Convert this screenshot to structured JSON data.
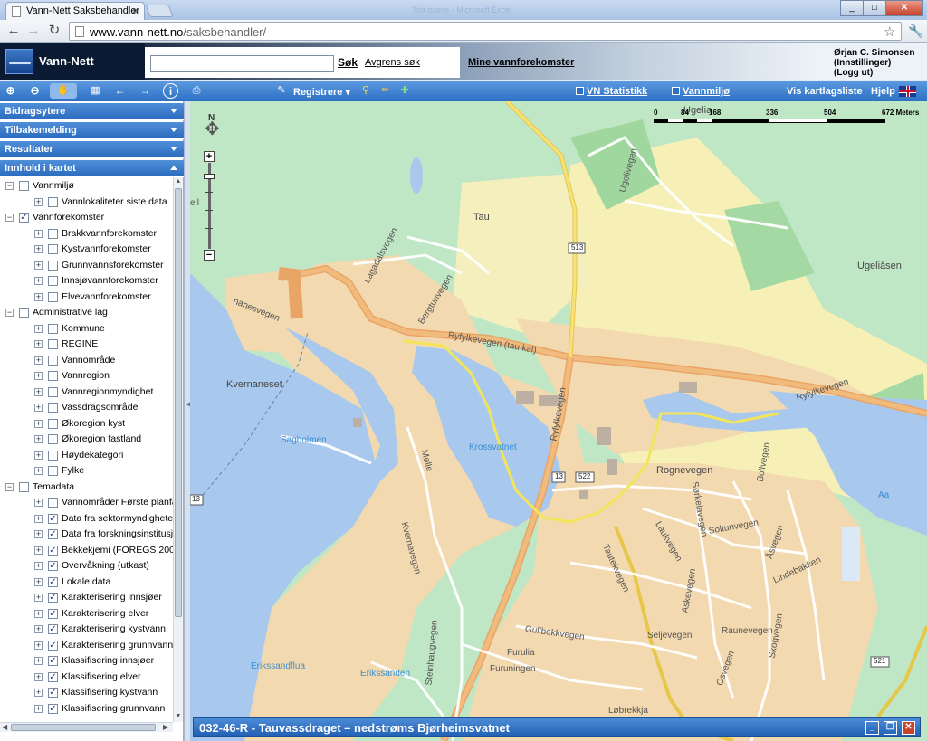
{
  "browser": {
    "tab_title": "Vann-Nett Saksbehandler",
    "tab_close": "×",
    "ghost_title": "Tint guess - Microsoft Excel",
    "url_host": "www.vann-nett.no",
    "url_path": "/saksbehandler/",
    "nav_back": "←",
    "nav_forward": "→",
    "nav_reload": "↻",
    "star": "☆",
    "wrench": "🔧",
    "win_min": "_",
    "win_max": "□",
    "win_close": "✕"
  },
  "header": {
    "app_name": "Vann-Nett",
    "search_placeholder": "",
    "search_button": "Søk",
    "refine_link": "Avgrens søk",
    "my_water_link": "Mine vannforekomster",
    "user_name": "Ørjan C. Simonsen",
    "user_settings": "(Innstillinger)",
    "user_logout": "(Logg ut)"
  },
  "toolbar": {
    "register": "Registrere",
    "vn_stats": "VN Statistikk",
    "water_env": "Vannmiljø",
    "layer_list": "Vis kartlagsliste",
    "help": "Hjelp"
  },
  "sidebar": {
    "accordions": [
      "Bidragsytere",
      "Tilbakemelding",
      "Resultater",
      "Innhold i kartet"
    ],
    "tree": [
      {
        "level": 0,
        "label": "Vannmiljø",
        "checked": false,
        "expander": "−"
      },
      {
        "level": 1,
        "label": "Vannlokaliteter siste data",
        "checked": false,
        "expander": "+"
      },
      {
        "level": 0,
        "label": "Vannforekomster",
        "checked": true,
        "expander": "−"
      },
      {
        "level": 1,
        "label": "Brakkvannforekomster",
        "checked": false,
        "expander": "+"
      },
      {
        "level": 1,
        "label": "Kystvannforekomster",
        "checked": false,
        "expander": "+"
      },
      {
        "level": 1,
        "label": "Grunnvannsforekomster",
        "checked": false,
        "expander": "+"
      },
      {
        "level": 1,
        "label": "Innsjøvannforekomster",
        "checked": false,
        "expander": "+"
      },
      {
        "level": 1,
        "label": "Elvevannforekomster",
        "checked": false,
        "expander": "+"
      },
      {
        "level": 0,
        "label": "Administrative lag",
        "checked": false,
        "expander": "−"
      },
      {
        "level": 1,
        "label": "Kommune",
        "checked": false,
        "expander": "+"
      },
      {
        "level": 1,
        "label": "REGINE",
        "checked": false,
        "expander": "+"
      },
      {
        "level": 1,
        "label": "Vannområde",
        "checked": false,
        "expander": "+"
      },
      {
        "level": 1,
        "label": "Vannregion",
        "checked": false,
        "expander": "+"
      },
      {
        "level": 1,
        "label": "Vannregionmyndighet",
        "checked": false,
        "expander": "+"
      },
      {
        "level": 1,
        "label": "Vassdragsområde",
        "checked": false,
        "expander": "+"
      },
      {
        "level": 1,
        "label": "Økoregion kyst",
        "checked": false,
        "expander": "+"
      },
      {
        "level": 1,
        "label": "Økoregion fastland",
        "checked": false,
        "expander": "+"
      },
      {
        "level": 1,
        "label": "Høydekategori",
        "checked": false,
        "expander": "+"
      },
      {
        "level": 1,
        "label": "Fylke",
        "checked": false,
        "expander": "+"
      },
      {
        "level": 0,
        "label": "Temadata",
        "checked": false,
        "expander": "−"
      },
      {
        "level": 1,
        "label": "Vannområder Første planfa",
        "checked": false,
        "expander": "+"
      },
      {
        "level": 1,
        "label": "Data fra sektormyndighete",
        "checked": true,
        "expander": "+"
      },
      {
        "level": 1,
        "label": "Data fra forskningsinstitusj",
        "checked": true,
        "expander": "+"
      },
      {
        "level": 1,
        "label": "Bekkekjemi (FOREGS 2008",
        "checked": true,
        "expander": "+"
      },
      {
        "level": 1,
        "label": "Overvåkning (utkast)",
        "checked": true,
        "expander": "+"
      },
      {
        "level": 1,
        "label": "Lokale data",
        "checked": true,
        "expander": "+"
      },
      {
        "level": 1,
        "label": "Karakterisering innsjøer",
        "checked": true,
        "expander": "+"
      },
      {
        "level": 1,
        "label": "Karakterisering elver",
        "checked": true,
        "expander": "+"
      },
      {
        "level": 1,
        "label": "Karakterisering kystvann",
        "checked": true,
        "expander": "+"
      },
      {
        "level": 1,
        "label": "Karakterisering grunnvann",
        "checked": true,
        "expander": "+"
      },
      {
        "level": 1,
        "label": "Klassifisering innsjøer",
        "checked": true,
        "expander": "+"
      },
      {
        "level": 1,
        "label": "Klassifisering elver",
        "checked": true,
        "expander": "+"
      },
      {
        "level": 1,
        "label": "Klassifisering kystvann",
        "checked": true,
        "expander": "+"
      },
      {
        "level": 1,
        "label": "Klassifisering grunnvann",
        "checked": true,
        "expander": "+"
      }
    ]
  },
  "map": {
    "scale_labels": [
      "0",
      "84",
      "168",
      "336",
      "504",
      "672 Meters"
    ],
    "pan_label": "N",
    "zoom_in": "+",
    "zoom_out": "−",
    "labels": {
      "ugelia": "Ugelia",
      "ugelivegen": "Ugelivegen",
      "tau": "Tau",
      "ugeliasen": "Ugeliåsen",
      "ell": "ell",
      "road513": "513",
      "nanesvegen": "nanesvegen",
      "bergtunvegen": "Bergtunvegen",
      "lagadalsvegen": "Lagadalsvegen",
      "ryfylkevegen_taukai": "Ryfylkevegen (tau kai)",
      "ryfylkevegen": "Ryfylkevegen",
      "ryfylkevegen_e": "Ryfylkevegen",
      "kvernaneset": "Kvernaneset",
      "sagholmen": "Sagholmen",
      "krossvatnet": "Krossvatnet",
      "kvernavegen": "Kvernavegen",
      "molle": "Mølle",
      "road13a": "13",
      "road13b": "13",
      "road522": "522",
      "rognevegen": "Rognevegen",
      "sorkelavegen": "Sørkelavegen",
      "bollvegen": "Bollvegen",
      "soltunvegen": "Soltunvegen",
      "laukvegen": "Laukvegen",
      "tautekvegen": "Tautekvegen",
      "asvegen": "Åsvegen",
      "lindebakken": "Lindebakken",
      "aa": "Aa",
      "seljevegen": "Seljevegen",
      "raunevegen": "Raunevegen",
      "asbakken": "Askevegen",
      "gullbekkvegen": "Gullbekkvegen",
      "furulia": "Furulia",
      "furuningen": "Furuningen",
      "eriksandflua": "Erikssandflua",
      "erikssanden": "Erikssanden",
      "osloveien": "Osvegen",
      "skogvegen": "Skogvegen",
      "lobrekkja": "Løbrekkja",
      "road521": "521",
      "steinhaugvegen": "Steinhaugvegen"
    }
  },
  "infobar": {
    "title": "032-46-R - Tauvassdraget – nedstrøms Bjørheimsvatnet",
    "min": "_",
    "restore": "❐",
    "close": "✕"
  }
}
